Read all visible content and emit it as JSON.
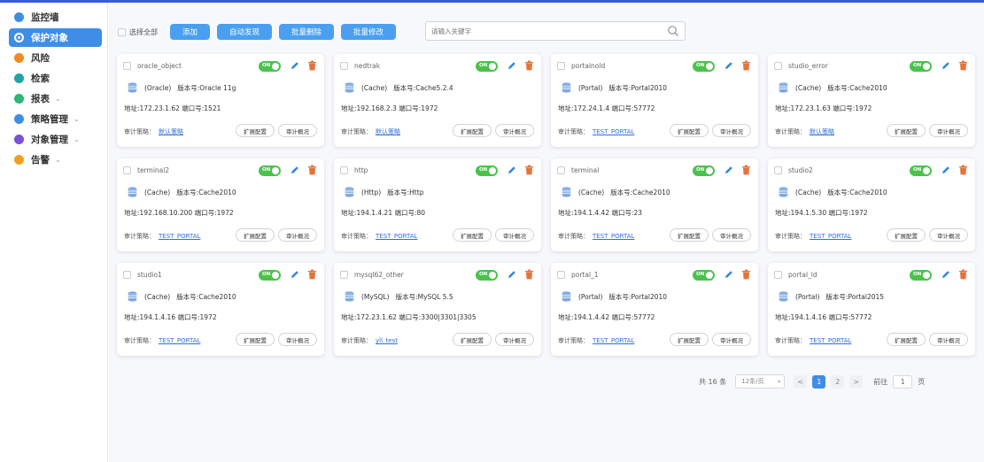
{
  "sidebar": {
    "items": [
      {
        "label": "监控墙",
        "icon": "eye-icon",
        "color": "#3f8ee6",
        "chevron": false,
        "active": false
      },
      {
        "label": "保护对象",
        "icon": "shield-icon",
        "color": "#3f8ee6",
        "chevron": false,
        "active": true
      },
      {
        "label": "风险",
        "icon": "warning-icon",
        "color": "#f08a24",
        "chevron": false,
        "active": false
      },
      {
        "label": "检索",
        "icon": "search-icon",
        "color": "#21a3a3",
        "chevron": false,
        "active": false
      },
      {
        "label": "报表",
        "icon": "report-icon",
        "color": "#2bb673",
        "chevron": true,
        "active": false
      },
      {
        "label": "策略管理",
        "icon": "strategy-icon",
        "color": "#3f8ee6",
        "chevron": true,
        "active": false
      },
      {
        "label": "对象管理",
        "icon": "object-icon",
        "color": "#7b4fd6",
        "chevron": true,
        "active": false
      },
      {
        "label": "告警",
        "icon": "alarm-icon",
        "color": "#f0a020",
        "chevron": true,
        "active": false
      }
    ],
    "chevron_glyph": "⌄"
  },
  "toolbar": {
    "select_all_label": "选择全部",
    "buttons": [
      "添加",
      "自动发现",
      "批量删除",
      "批量修改"
    ],
    "search_placeholder": "请输入关键字"
  },
  "card_labels": {
    "version_prefix": "版本号:",
    "address_prefix": "地址:",
    "port_prefix": "端口号:",
    "policy_prefix": "审计策略：",
    "ext_config": "扩展配置",
    "audit_overview": "审计概况",
    "toggle_on": "ON"
  },
  "cards": [
    {
      "name": "oracle_object",
      "type": "(Oracle)",
      "version": "Oracle 11g",
      "address": "172.23.1.62",
      "port": "1521",
      "policy": "默认策略"
    },
    {
      "name": "nedtrak",
      "type": "(Cache)",
      "version": "Cache5.2.4",
      "address": "192.168.2.3",
      "port": "1972",
      "policy": "默认策略"
    },
    {
      "name": "portalnold",
      "type": "(Portal)",
      "version": "Portal2010",
      "address": "172.24.1.4",
      "port": "57772",
      "policy": "TEST_PORTAL"
    },
    {
      "name": "studio_error",
      "type": "(Cache)",
      "version": "Cache2010",
      "address": "172.23.1.63",
      "port": "1972",
      "policy": "默认策略"
    },
    {
      "name": "terminal2",
      "type": "(Cache)",
      "version": "Cache2010",
      "address": "192.168.10.200",
      "port": "1972",
      "policy": "TEST_PORTAL"
    },
    {
      "name": "http",
      "type": "(Http)",
      "version": "Http",
      "address": "194.1.4.21",
      "port": "80",
      "policy": "TEST_PORTAL"
    },
    {
      "name": "terminal",
      "type": "(Cache)",
      "version": "Cache2010",
      "address": "194.1.4.42",
      "port": "23",
      "policy": "TEST_PORTAL"
    },
    {
      "name": "studio2",
      "type": "(Cache)",
      "version": "Cache2010",
      "address": "194.1.5.30",
      "port": "1972",
      "policy": "TEST_PORTAL"
    },
    {
      "name": "studio1",
      "type": "(Cache)",
      "version": "Cache2010",
      "address": "194.1.4.16",
      "port": "1972",
      "policy": "TEST_PORTAL"
    },
    {
      "name": "mysql62_other",
      "type": "(MySQL)",
      "version": "MySQL 5.5",
      "address": "172.23.1.62",
      "port": "3300|3301|3305",
      "policy": "yll_test"
    },
    {
      "name": "portal_1",
      "type": "(Portal)",
      "version": "Portal2010",
      "address": "194.1.4.42",
      "port": "57772",
      "policy": "TEST_PORTAL"
    },
    {
      "name": "portal_ld",
      "type": "(Portal)",
      "version": "Portal2015",
      "address": "194.1.4.16",
      "port": "57772",
      "policy": "TEST_PORTAL"
    }
  ],
  "pagination": {
    "total_label": "共 16 条",
    "page_size": "12条/页",
    "prev": "<",
    "pages": [
      "1",
      "2"
    ],
    "current_page": "1",
    "next": ">",
    "goto_label": "前往",
    "goto_value": "1",
    "page_unit": "页"
  },
  "colors": {
    "primary": "#4a9ff0",
    "active_nav": "#3f8ee6",
    "toggle_on": "#4bc24b",
    "edit": "#2f86e0",
    "delete": "#e2743b",
    "link": "#2f6fdc"
  }
}
